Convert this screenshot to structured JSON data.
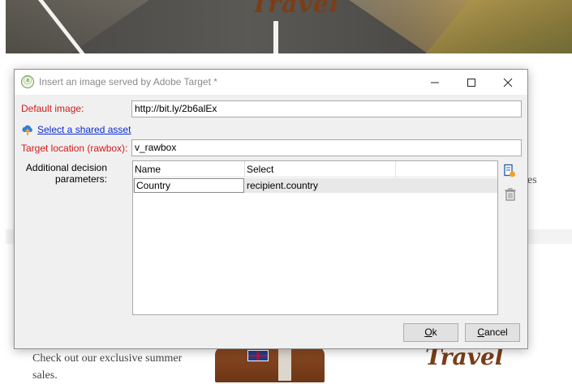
{
  "background": {
    "hero_title": "Travel",
    "side_text": "es",
    "promo_text": "Check out our exclusive summer sales.",
    "footer_logo": "Travel"
  },
  "dialog": {
    "title": "Insert an image served by Adobe Target *",
    "app_icon": "adobe-target-icon",
    "default_image_label": "Default image:",
    "default_image_value": "http://bit.ly/2b6alEx",
    "shared_asset_link": "Select a shared asset",
    "target_location_label": "Target location (rawbox):",
    "target_location_value": "v_rawbox",
    "additional_label_line1": "Additional decision",
    "additional_label_line2": "parameters:",
    "table": {
      "columns": [
        "Name",
        "Select"
      ],
      "rows": [
        {
          "name": "Country",
          "select": "recipient.country"
        }
      ]
    },
    "side_icons": [
      "add-parameter-icon",
      "trash-icon"
    ],
    "ok_label_underlined": "O",
    "ok_label_rest": "k",
    "cancel_label_underlined": "C",
    "cancel_label_rest": "ancel"
  },
  "colors": {
    "required_label": "#d11a1a",
    "link": "#0a2bd0",
    "dialog_bg": "#f0f0f0",
    "brand_brown": "#7a3e17"
  }
}
